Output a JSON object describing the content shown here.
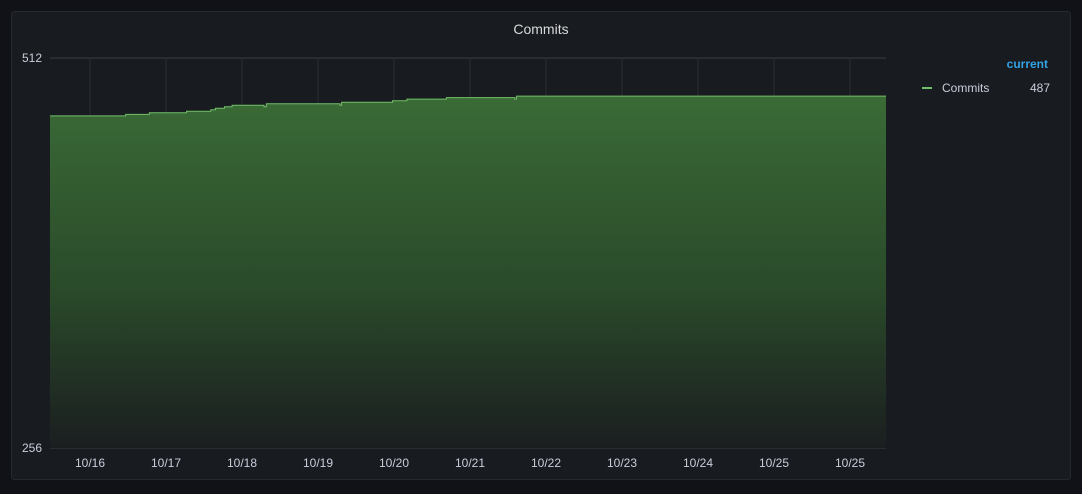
{
  "panel": {
    "title": "Commits"
  },
  "legend": {
    "header": "current",
    "series_name": "Commits",
    "series_value": "487"
  },
  "colors": {
    "series": "#73bf69",
    "accent": "#33a2e5",
    "background": "#111217",
    "panel": "#181b1f",
    "grid": "#3a3d42"
  },
  "chart_data": {
    "type": "area",
    "title": "Commits",
    "xlabel": "",
    "ylabel": "",
    "ylim": [
      256,
      512
    ],
    "yticks": [
      "512",
      "256"
    ],
    "xticks": [
      "10/16",
      "10/17",
      "10/18",
      "10/19",
      "10/20",
      "10/21",
      "10/22",
      "10/23",
      "10/24",
      "10/25",
      "10/25"
    ],
    "grid": true,
    "legend_placement": "right",
    "series": [
      {
        "name": "Commits",
        "current": 487,
        "x": [
          0,
          0.47,
          0.47,
          0.78,
          0.78,
          1.27,
          1.27,
          1.59,
          1.59,
          1.65,
          1.65,
          1.77,
          1.77,
          1.87,
          1.87,
          2.29,
          2.29,
          2.32,
          2.32,
          3.29,
          3.29,
          3.31,
          3.31,
          3.98,
          3.98,
          4.17,
          4.17,
          4.69,
          4.69,
          5.59,
          5.59,
          5.61,
          5.61,
          5.93,
          5.93,
          6.61
        ],
        "y": [
          474,
          474,
          475,
          475,
          476,
          476,
          477,
          477,
          478,
          478,
          479,
          479,
          480,
          480,
          481,
          481,
          480,
          480,
          482,
          482,
          481,
          481,
          483,
          483,
          484,
          484,
          485,
          485,
          486,
          486,
          485,
          485,
          487,
          487,
          487,
          487
        ]
      }
    ]
  }
}
